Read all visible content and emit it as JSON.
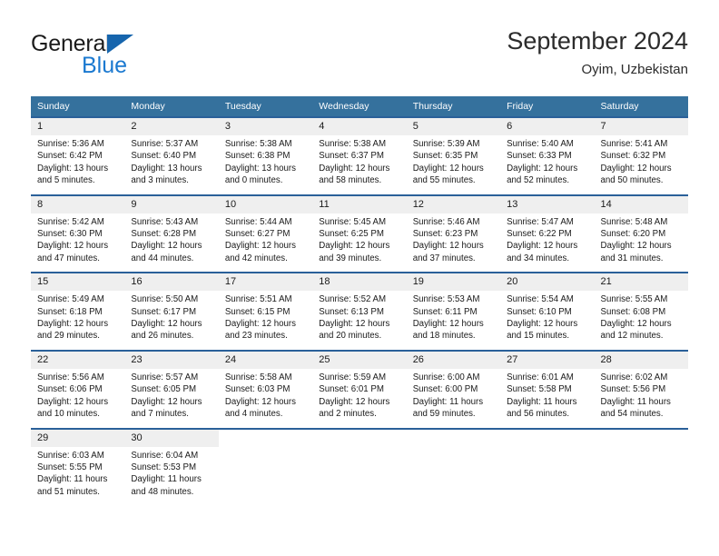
{
  "brand": {
    "name_top": "General",
    "name_bottom": "Blue",
    "triangle_color": "#1665ad",
    "blue_color": "#1b79d0"
  },
  "header": {
    "title": "September 2024",
    "subtitle": "Oyim, Uzbekistan"
  },
  "theme": {
    "header_bg": "#35719d",
    "row_border": "#2a6099",
    "daynum_bg": "#efefef"
  },
  "calendar": {
    "weekday_headers": [
      "Sunday",
      "Monday",
      "Tuesday",
      "Wednesday",
      "Thursday",
      "Friday",
      "Saturday"
    ],
    "weeks": [
      [
        {
          "day": "1",
          "sunrise": "Sunrise: 5:36 AM",
          "sunset": "Sunset: 6:42 PM",
          "daylight_1": "Daylight: 13 hours",
          "daylight_2": "and 5 minutes."
        },
        {
          "day": "2",
          "sunrise": "Sunrise: 5:37 AM",
          "sunset": "Sunset: 6:40 PM",
          "daylight_1": "Daylight: 13 hours",
          "daylight_2": "and 3 minutes."
        },
        {
          "day": "3",
          "sunrise": "Sunrise: 5:38 AM",
          "sunset": "Sunset: 6:38 PM",
          "daylight_1": "Daylight: 13 hours",
          "daylight_2": "and 0 minutes."
        },
        {
          "day": "4",
          "sunrise": "Sunrise: 5:38 AM",
          "sunset": "Sunset: 6:37 PM",
          "daylight_1": "Daylight: 12 hours",
          "daylight_2": "and 58 minutes."
        },
        {
          "day": "5",
          "sunrise": "Sunrise: 5:39 AM",
          "sunset": "Sunset: 6:35 PM",
          "daylight_1": "Daylight: 12 hours",
          "daylight_2": "and 55 minutes."
        },
        {
          "day": "6",
          "sunrise": "Sunrise: 5:40 AM",
          "sunset": "Sunset: 6:33 PM",
          "daylight_1": "Daylight: 12 hours",
          "daylight_2": "and 52 minutes."
        },
        {
          "day": "7",
          "sunrise": "Sunrise: 5:41 AM",
          "sunset": "Sunset: 6:32 PM",
          "daylight_1": "Daylight: 12 hours",
          "daylight_2": "and 50 minutes."
        }
      ],
      [
        {
          "day": "8",
          "sunrise": "Sunrise: 5:42 AM",
          "sunset": "Sunset: 6:30 PM",
          "daylight_1": "Daylight: 12 hours",
          "daylight_2": "and 47 minutes."
        },
        {
          "day": "9",
          "sunrise": "Sunrise: 5:43 AM",
          "sunset": "Sunset: 6:28 PM",
          "daylight_1": "Daylight: 12 hours",
          "daylight_2": "and 44 minutes."
        },
        {
          "day": "10",
          "sunrise": "Sunrise: 5:44 AM",
          "sunset": "Sunset: 6:27 PM",
          "daylight_1": "Daylight: 12 hours",
          "daylight_2": "and 42 minutes."
        },
        {
          "day": "11",
          "sunrise": "Sunrise: 5:45 AM",
          "sunset": "Sunset: 6:25 PM",
          "daylight_1": "Daylight: 12 hours",
          "daylight_2": "and 39 minutes."
        },
        {
          "day": "12",
          "sunrise": "Sunrise: 5:46 AM",
          "sunset": "Sunset: 6:23 PM",
          "daylight_1": "Daylight: 12 hours",
          "daylight_2": "and 37 minutes."
        },
        {
          "day": "13",
          "sunrise": "Sunrise: 5:47 AM",
          "sunset": "Sunset: 6:22 PM",
          "daylight_1": "Daylight: 12 hours",
          "daylight_2": "and 34 minutes."
        },
        {
          "day": "14",
          "sunrise": "Sunrise: 5:48 AM",
          "sunset": "Sunset: 6:20 PM",
          "daylight_1": "Daylight: 12 hours",
          "daylight_2": "and 31 minutes."
        }
      ],
      [
        {
          "day": "15",
          "sunrise": "Sunrise: 5:49 AM",
          "sunset": "Sunset: 6:18 PM",
          "daylight_1": "Daylight: 12 hours",
          "daylight_2": "and 29 minutes."
        },
        {
          "day": "16",
          "sunrise": "Sunrise: 5:50 AM",
          "sunset": "Sunset: 6:17 PM",
          "daylight_1": "Daylight: 12 hours",
          "daylight_2": "and 26 minutes."
        },
        {
          "day": "17",
          "sunrise": "Sunrise: 5:51 AM",
          "sunset": "Sunset: 6:15 PM",
          "daylight_1": "Daylight: 12 hours",
          "daylight_2": "and 23 minutes."
        },
        {
          "day": "18",
          "sunrise": "Sunrise: 5:52 AM",
          "sunset": "Sunset: 6:13 PM",
          "daylight_1": "Daylight: 12 hours",
          "daylight_2": "and 20 minutes."
        },
        {
          "day": "19",
          "sunrise": "Sunrise: 5:53 AM",
          "sunset": "Sunset: 6:11 PM",
          "daylight_1": "Daylight: 12 hours",
          "daylight_2": "and 18 minutes."
        },
        {
          "day": "20",
          "sunrise": "Sunrise: 5:54 AM",
          "sunset": "Sunset: 6:10 PM",
          "daylight_1": "Daylight: 12 hours",
          "daylight_2": "and 15 minutes."
        },
        {
          "day": "21",
          "sunrise": "Sunrise: 5:55 AM",
          "sunset": "Sunset: 6:08 PM",
          "daylight_1": "Daylight: 12 hours",
          "daylight_2": "and 12 minutes."
        }
      ],
      [
        {
          "day": "22",
          "sunrise": "Sunrise: 5:56 AM",
          "sunset": "Sunset: 6:06 PM",
          "daylight_1": "Daylight: 12 hours",
          "daylight_2": "and 10 minutes."
        },
        {
          "day": "23",
          "sunrise": "Sunrise: 5:57 AM",
          "sunset": "Sunset: 6:05 PM",
          "daylight_1": "Daylight: 12 hours",
          "daylight_2": "and 7 minutes."
        },
        {
          "day": "24",
          "sunrise": "Sunrise: 5:58 AM",
          "sunset": "Sunset: 6:03 PM",
          "daylight_1": "Daylight: 12 hours",
          "daylight_2": "and 4 minutes."
        },
        {
          "day": "25",
          "sunrise": "Sunrise: 5:59 AM",
          "sunset": "Sunset: 6:01 PM",
          "daylight_1": "Daylight: 12 hours",
          "daylight_2": "and 2 minutes."
        },
        {
          "day": "26",
          "sunrise": "Sunrise: 6:00 AM",
          "sunset": "Sunset: 6:00 PM",
          "daylight_1": "Daylight: 11 hours",
          "daylight_2": "and 59 minutes."
        },
        {
          "day": "27",
          "sunrise": "Sunrise: 6:01 AM",
          "sunset": "Sunset: 5:58 PM",
          "daylight_1": "Daylight: 11 hours",
          "daylight_2": "and 56 minutes."
        },
        {
          "day": "28",
          "sunrise": "Sunrise: 6:02 AM",
          "sunset": "Sunset: 5:56 PM",
          "daylight_1": "Daylight: 11 hours",
          "daylight_2": "and 54 minutes."
        }
      ],
      [
        {
          "day": "29",
          "sunrise": "Sunrise: 6:03 AM",
          "sunset": "Sunset: 5:55 PM",
          "daylight_1": "Daylight: 11 hours",
          "daylight_2": "and 51 minutes."
        },
        {
          "day": "30",
          "sunrise": "Sunrise: 6:04 AM",
          "sunset": "Sunset: 5:53 PM",
          "daylight_1": "Daylight: 11 hours",
          "daylight_2": "and 48 minutes."
        },
        {
          "day": "",
          "sunrise": "",
          "sunset": "",
          "daylight_1": "",
          "daylight_2": ""
        },
        {
          "day": "",
          "sunrise": "",
          "sunset": "",
          "daylight_1": "",
          "daylight_2": ""
        },
        {
          "day": "",
          "sunrise": "",
          "sunset": "",
          "daylight_1": "",
          "daylight_2": ""
        },
        {
          "day": "",
          "sunrise": "",
          "sunset": "",
          "daylight_1": "",
          "daylight_2": ""
        },
        {
          "day": "",
          "sunrise": "",
          "sunset": "",
          "daylight_1": "",
          "daylight_2": ""
        }
      ]
    ]
  }
}
